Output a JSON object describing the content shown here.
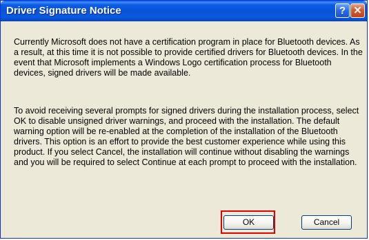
{
  "window": {
    "title": "Driver Signature Notice",
    "help_icon": "help-question-icon",
    "help_label": "?",
    "close_icon": "close-x-icon",
    "close_label": "✕"
  },
  "body": {
    "paragraph1": "Currently Microsoft does not have a certification program in place for Bluetooth devices. As a result, at this time it is not possible to provide certified drivers for Bluetooth devices.  In the event that Microsoft implements a Windows Logo certification process for Bluetooth devices, signed drivers will be made available.",
    "paragraph2": "To avoid receiving several prompts for signed drivers during the installation process, select OK to disable unsigned driver warnings, and proceed with the installation. The default warning option will be re-enabled at the completion of the installation of the Bluetooth drivers. This option is an effort to provide the best customer experience while using this product. If you select Cancel, the installation will continue without disabling the warnings and you will be required to select Continue at each prompt to proceed with the installation."
  },
  "buttons": {
    "ok_label": "OK",
    "cancel_label": "Cancel"
  },
  "colors": {
    "titlebar": "#0853d8",
    "window_bg": "#ece9d8",
    "highlight_border": "#e00000"
  }
}
